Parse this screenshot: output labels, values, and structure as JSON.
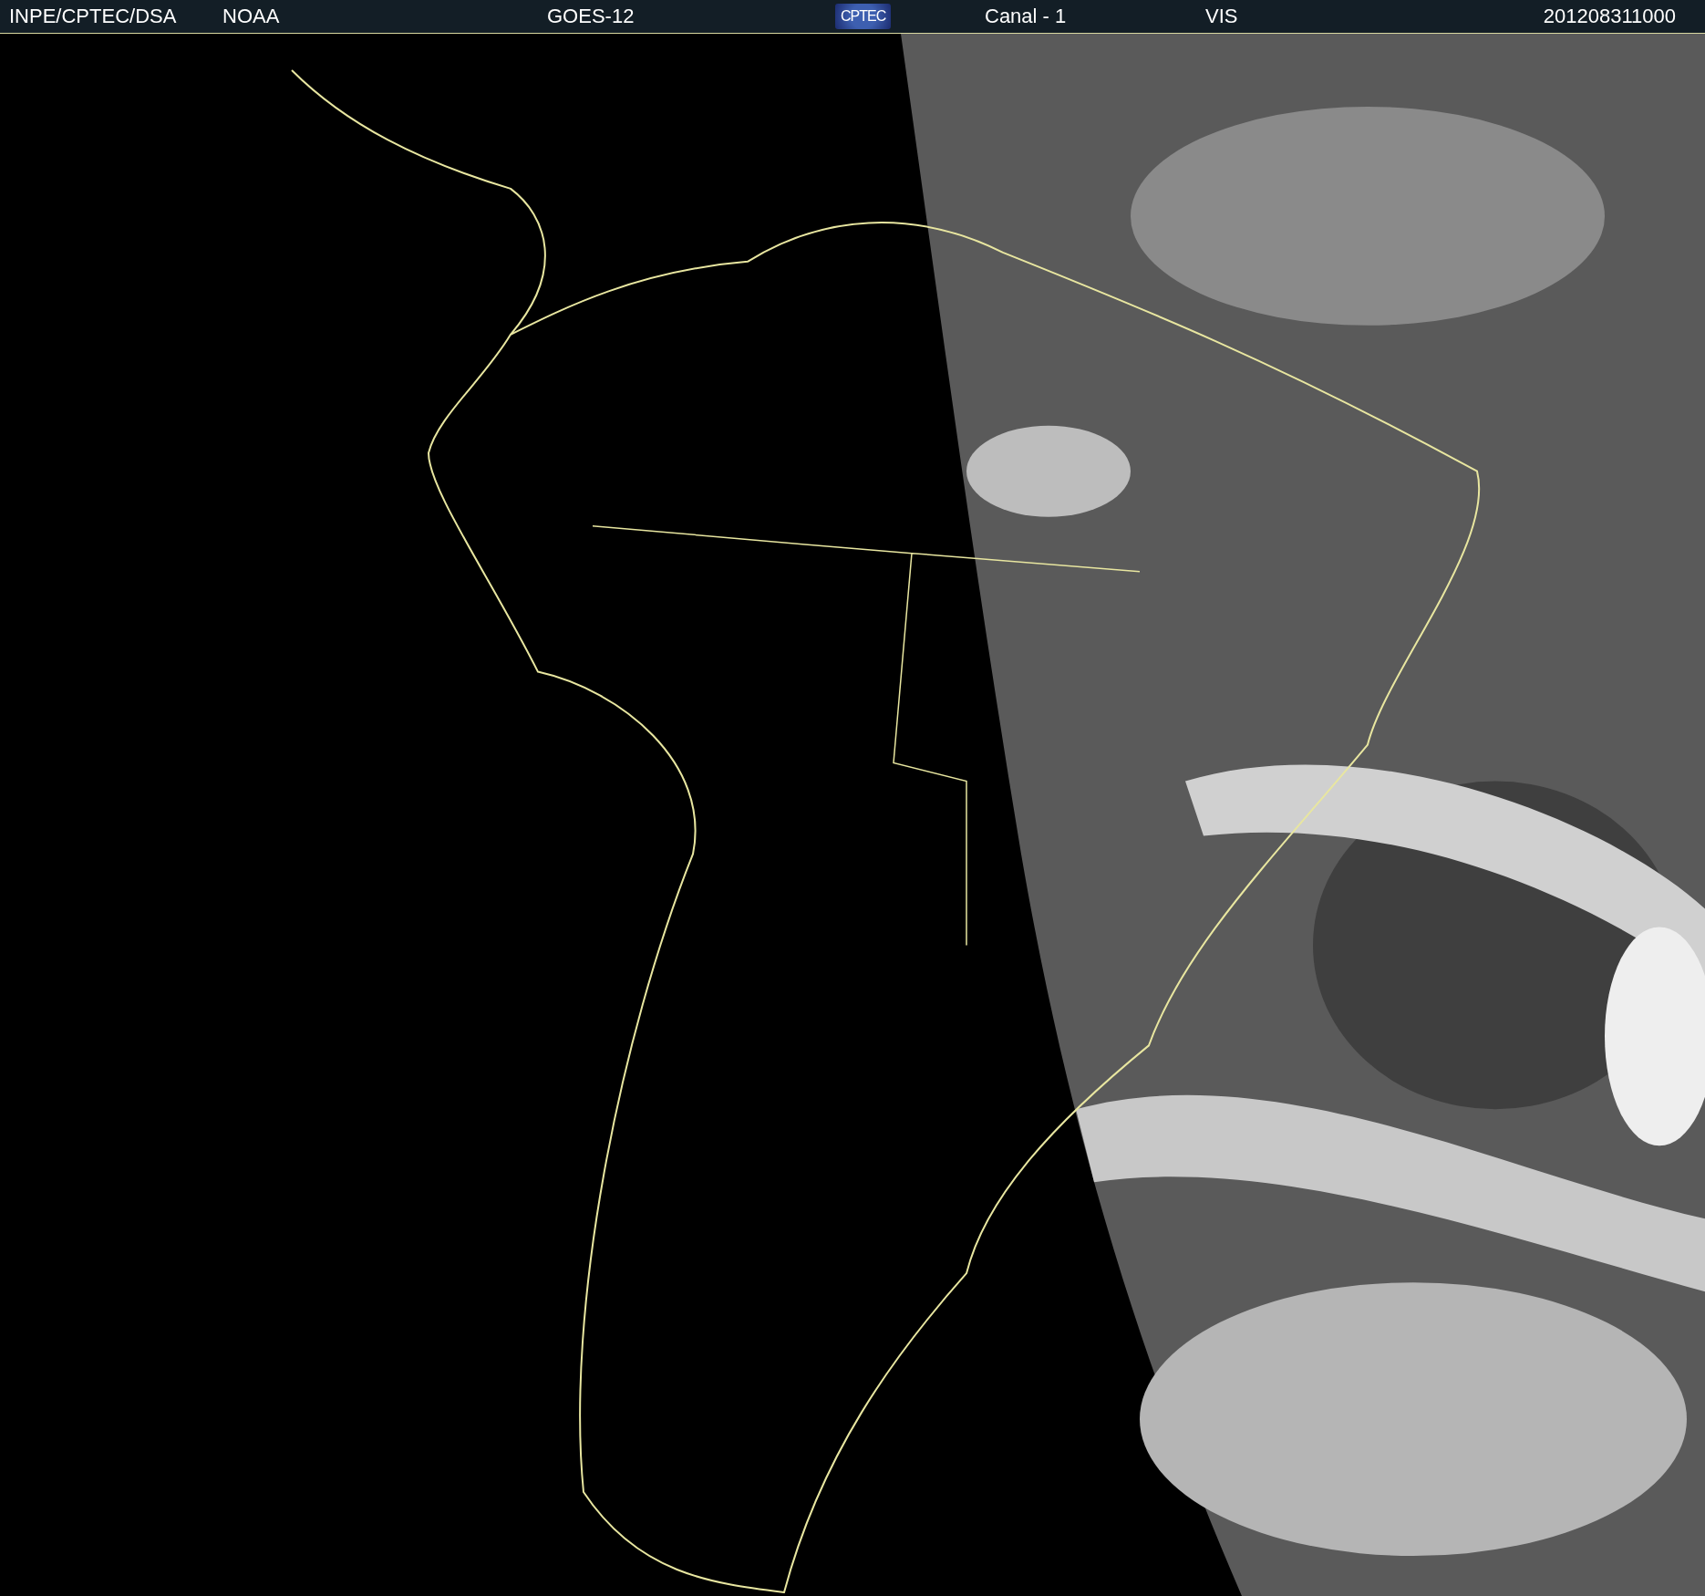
{
  "header": {
    "items": [
      {
        "kind": "text",
        "label": "INPE/CPTEC/DSA"
      },
      {
        "kind": "text",
        "label": "NOAA"
      },
      {
        "kind": "text",
        "label": "GOES-12"
      },
      {
        "kind": "logo",
        "label": "CPTEC"
      },
      {
        "kind": "text",
        "label": "Canal - 1"
      },
      {
        "kind": "text",
        "label": "VIS"
      },
      {
        "kind": "text",
        "label": "201208311000"
      }
    ]
  }
}
